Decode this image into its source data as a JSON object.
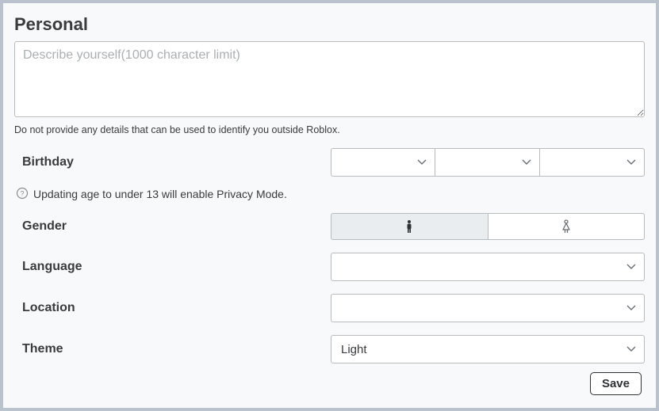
{
  "section_title": "Personal",
  "bio": {
    "value": "",
    "placeholder": "Describe yourself(1000 character limit)",
    "helper": "Do not provide any details that can be used to identify you outside Roblox."
  },
  "birthday": {
    "label": "Birthday",
    "month": "",
    "day": "",
    "year": "",
    "notice": "Updating age to under 13 will enable Privacy Mode."
  },
  "gender": {
    "label": "Gender",
    "selected": "male"
  },
  "language": {
    "label": "Language",
    "value": ""
  },
  "location": {
    "label": "Location",
    "value": ""
  },
  "theme": {
    "label": "Theme",
    "value": "Light"
  },
  "save_label": "Save"
}
